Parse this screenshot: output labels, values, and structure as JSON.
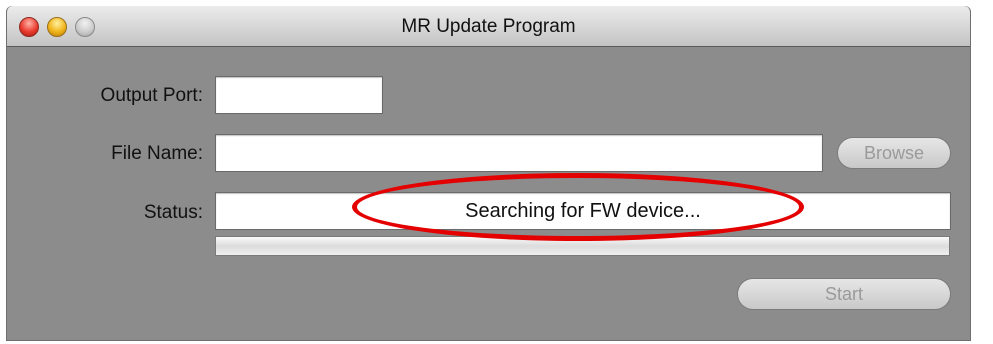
{
  "window": {
    "title": "MR Update Program"
  },
  "form": {
    "output_port_label": "Output Port:",
    "output_port_value": "",
    "file_name_label": "File Name:",
    "file_name_value": "",
    "browse_label": "Browse",
    "status_label": "Status:",
    "status_value": "Searching for FW device...",
    "progress_fraction": 0,
    "start_label": "Start"
  },
  "annotation": {
    "color": "#e50000"
  }
}
